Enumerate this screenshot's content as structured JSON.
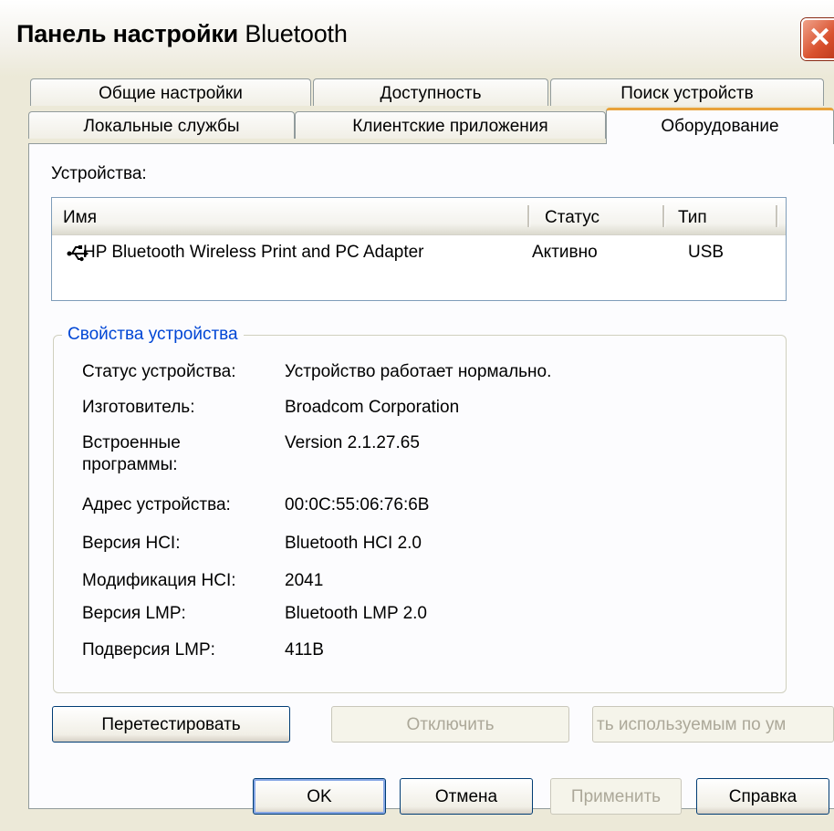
{
  "window": {
    "title_bold": "Панель настройки",
    "title_rest": " Bluetooth",
    "close_glyph": "✕"
  },
  "tabs": {
    "row1": [
      "Общие настройки",
      "Доступность",
      "Поиск устройств"
    ],
    "row2": [
      "Локальные службы",
      "Клиентские приложения",
      "Оборудование"
    ],
    "active": "Оборудование"
  },
  "devices": {
    "label": "Устройства:",
    "columns": [
      "Имя",
      "Статус",
      "Тип"
    ],
    "rows": [
      {
        "name": "HP Bluetooth Wireless Print and PC Adapter",
        "status": "Активно",
        "type": "USB",
        "icon": "usb-icon"
      }
    ]
  },
  "properties": {
    "group_title": "Свойства устройства",
    "items": [
      {
        "label": "Статус устройства:",
        "value": "Устройство работает нормально."
      },
      {
        "label": "Изготовитель:",
        "value": "Broadcom Corporation"
      },
      {
        "label": "Встроенные",
        "label2": "программы:",
        "value": "Version 2.1.27.65"
      },
      {
        "label": "Адрес устройства:",
        "value": "00:0C:55:06:76:6B"
      },
      {
        "label": "Версия HCI:",
        "value": "Bluetooth HCI 2.0"
      },
      {
        "label": "Модификация HCI:",
        "value": "2041"
      },
      {
        "label": "Версия LMP:",
        "value": "Bluetooth LMP 2.0"
      },
      {
        "label": "Подверсия LMP:",
        "value": "411B"
      }
    ]
  },
  "buttons": {
    "retest": "Перетестировать",
    "disable": "Отключить",
    "set_default": "ть используемым по ум",
    "ok": "OK",
    "cancel": "Отмена",
    "apply": "Применить",
    "help": "Справка"
  }
}
